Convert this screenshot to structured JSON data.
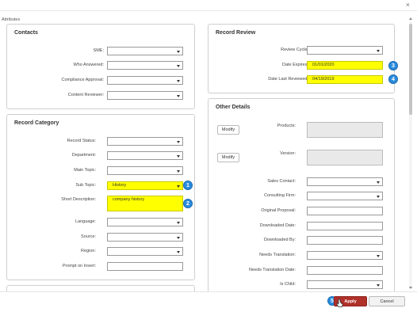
{
  "header": {
    "close_glyph": "×",
    "subtitle": "Attributes"
  },
  "contacts": {
    "title": "Contacts",
    "fields": [
      {
        "label": "SME:",
        "value": ""
      },
      {
        "label": "Who Answered:",
        "value": ""
      },
      {
        "label": "Compliance Approval:",
        "value": ""
      },
      {
        "label": "Content Reviewer:",
        "value": ""
      }
    ]
  },
  "record_category": {
    "title": "Record Category",
    "fields": [
      {
        "label": "Record Status:",
        "value": ""
      },
      {
        "label": "Department:",
        "value": ""
      },
      {
        "label": "Main Topic:",
        "value": ""
      },
      {
        "label": "Sub Topic:",
        "value": "History"
      },
      {
        "label": "Short Description:",
        "value": "company history"
      },
      {
        "label": "Language:",
        "value": ""
      },
      {
        "label": "Source:",
        "value": ""
      },
      {
        "label": "Region:",
        "value": ""
      },
      {
        "label": "Prompt on Insert:",
        "value": ""
      }
    ]
  },
  "record_review": {
    "title": "Record Review",
    "fields": [
      {
        "label": "Review Cycle:",
        "value": ""
      },
      {
        "label": "Date Expires:",
        "value": "01/01/2020"
      },
      {
        "label": "Date Last Reviewed:",
        "value": "04/19/2019"
      }
    ]
  },
  "other_details": {
    "title": "Other Details",
    "modify_label": "Modify",
    "fields": [
      {
        "label": "Products:",
        "value": ""
      },
      {
        "label": "Version:",
        "value": ""
      },
      {
        "label": "Sales Contact:",
        "value": ""
      },
      {
        "label": "Consulting Firm:",
        "value": ""
      },
      {
        "label": "Original Proposal:",
        "value": ""
      },
      {
        "label": "Downloaded Date:",
        "value": ""
      },
      {
        "label": "Downloaded By:",
        "value": ""
      },
      {
        "label": "Needs Translation:",
        "value": ""
      },
      {
        "label": "Needs Translation Date:",
        "value": ""
      },
      {
        "label": "Is Child:",
        "value": ""
      }
    ]
  },
  "badges": [
    "1",
    "2",
    "3",
    "4",
    "5"
  ],
  "footer": {
    "apply_label": "Apply",
    "cancel_label": "Cancel"
  },
  "colors": {
    "highlight": "#ffff00",
    "badge": "#2a8bdc",
    "apply": "#b0302a"
  }
}
